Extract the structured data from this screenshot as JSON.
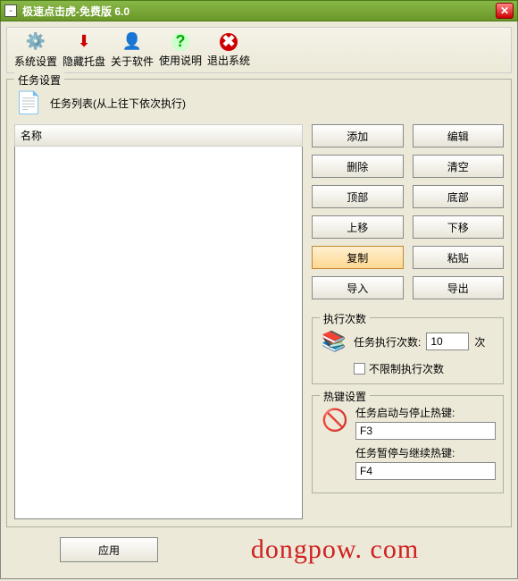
{
  "title": "极速点击虎-免费版 6.0",
  "toolbar": [
    {
      "label": "系统设置",
      "icon": "⚙️",
      "name": "system-settings"
    },
    {
      "label": "隐藏托盘",
      "icon": "⬇",
      "name": "hide-tray",
      "color": "#c00"
    },
    {
      "label": "关于软件",
      "icon": "👤",
      "name": "about"
    },
    {
      "label": "使用说明",
      "icon": "?",
      "name": "help",
      "color": "#0a0",
      "bg": "#cfc"
    },
    {
      "label": "退出系统",
      "icon": "✖",
      "name": "exit",
      "color": "#fff",
      "bg": "#c00"
    }
  ],
  "group": {
    "title": "任务设置",
    "header_text": "任务列表(从上往下依次执行)",
    "column_header": "名称"
  },
  "buttons": [
    [
      "添加",
      "编辑"
    ],
    [
      "删除",
      "清空"
    ],
    [
      "顶部",
      "底部"
    ],
    [
      "上移",
      "下移"
    ],
    [
      "复制",
      "粘贴"
    ],
    [
      "导入",
      "导出"
    ]
  ],
  "highlight_button": "复制",
  "exec": {
    "title": "执行次数",
    "label": "任务执行次数:",
    "value": "10",
    "suffix": "次",
    "unlimited_label": "不限制执行次数"
  },
  "hotkey": {
    "title": "热键设置",
    "start_label": "任务启动与停止热键:",
    "start_value": "F3",
    "pause_label": "任务暂停与继续热键:",
    "pause_value": "F4"
  },
  "apply_label": "应用",
  "watermark": "dongpow. com"
}
